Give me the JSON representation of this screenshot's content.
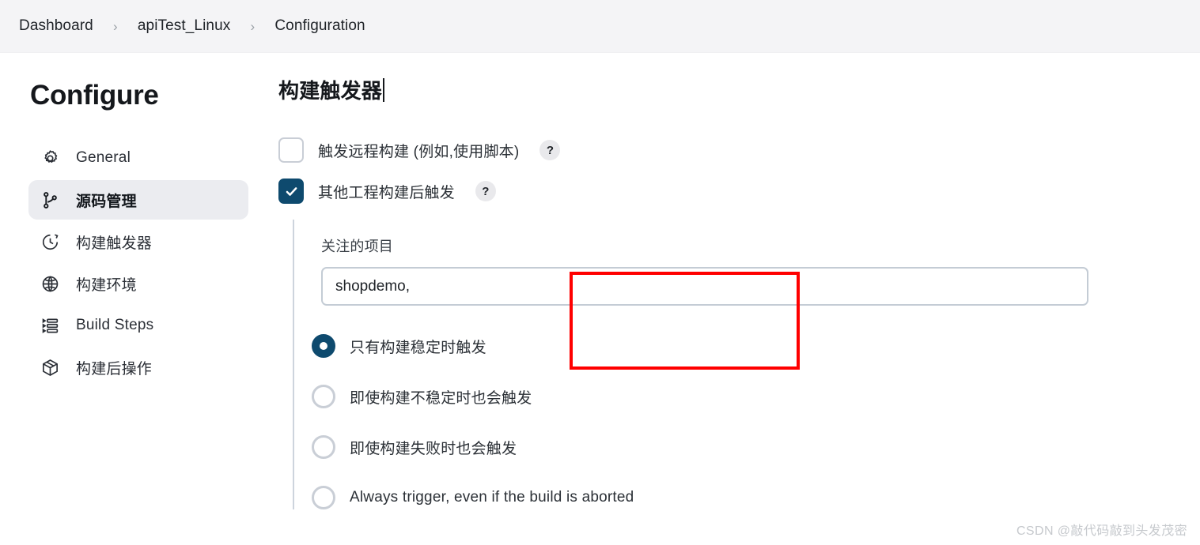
{
  "breadcrumb": {
    "items": [
      {
        "label": "Dashboard"
      },
      {
        "label": "apiTest_Linux"
      },
      {
        "label": "Configuration"
      }
    ],
    "separator": "›"
  },
  "sidebar": {
    "title": "Configure",
    "items": [
      {
        "label": "General",
        "icon": "gear-icon",
        "active": false
      },
      {
        "label": "源码管理",
        "icon": "git-branch-icon",
        "active": true
      },
      {
        "label": "构建触发器",
        "icon": "clock-icon",
        "active": false
      },
      {
        "label": "构建环境",
        "icon": "globe-icon",
        "active": false
      },
      {
        "label": "Build Steps",
        "icon": "list-steps-icon",
        "active": false
      },
      {
        "label": "构建后操作",
        "icon": "package-icon",
        "active": false
      }
    ]
  },
  "main": {
    "section_title": "构建触发器",
    "checkboxes": [
      {
        "label": "触发远程构建 (例如,使用脚本)",
        "checked": false,
        "help": "?"
      },
      {
        "label": "其他工程构建后触发",
        "checked": true,
        "help": "?"
      }
    ],
    "projects_field": {
      "label": "关注的项目",
      "value": "shopdemo,",
      "placeholder": ""
    },
    "radio_options": [
      {
        "label": "只有构建稳定时触发",
        "selected": true
      },
      {
        "label": "即使构建不稳定时也会触发",
        "selected": false
      },
      {
        "label": "即使构建失败时也会触发",
        "selected": false
      },
      {
        "label": "Always trigger, even if the build is aborted",
        "selected": false
      }
    ]
  },
  "watermark": "CSDN @敲代码敲到头发茂密",
  "colors": {
    "accent": "#0e4a6e",
    "header_bg": "#f4f4f6",
    "active_nav_bg": "#ebecf0",
    "annotation_red": "#ff0000",
    "border_gray": "#c4ccd5"
  }
}
